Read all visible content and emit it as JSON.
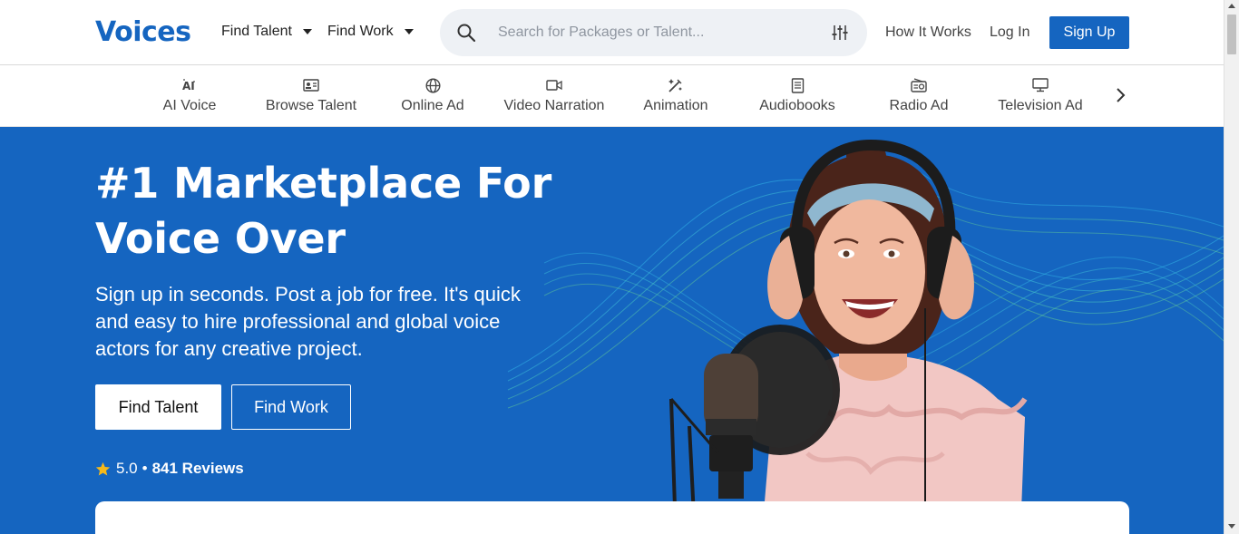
{
  "brand": {
    "logo_text": "Voices",
    "color": "#1565c0"
  },
  "header": {
    "nav": [
      {
        "label": "Find Talent"
      },
      {
        "label": "Find Work"
      }
    ],
    "search": {
      "placeholder": "Search for Packages or Talent..."
    },
    "links": {
      "how_it_works": "How It Works",
      "log_in": "Log In"
    },
    "sign_up": "Sign Up"
  },
  "categories": [
    {
      "label": "AI Voice",
      "icon": "ai-icon"
    },
    {
      "label": "Browse Talent",
      "icon": "id-card-icon"
    },
    {
      "label": "Online Ad",
      "icon": "globe-icon"
    },
    {
      "label": "Video Narration",
      "icon": "video-camera-icon"
    },
    {
      "label": "Animation",
      "icon": "magic-wand-icon"
    },
    {
      "label": "Audiobooks",
      "icon": "book-icon"
    },
    {
      "label": "Radio Ad",
      "icon": "radio-icon"
    },
    {
      "label": "Television Ad",
      "icon": "monitor-icon"
    }
  ],
  "hero": {
    "title": "#1 Marketplace For Voice Over",
    "subtitle": "Sign up in seconds. Post a job for free. It's quick and easy to hire professional and global voice actors for any creative project.",
    "primary_button": "Find Talent",
    "secondary_button": "Find Work",
    "rating": {
      "score": "5.0",
      "separator": "•",
      "reviews": "841 Reviews"
    },
    "background": "#1565c0"
  }
}
